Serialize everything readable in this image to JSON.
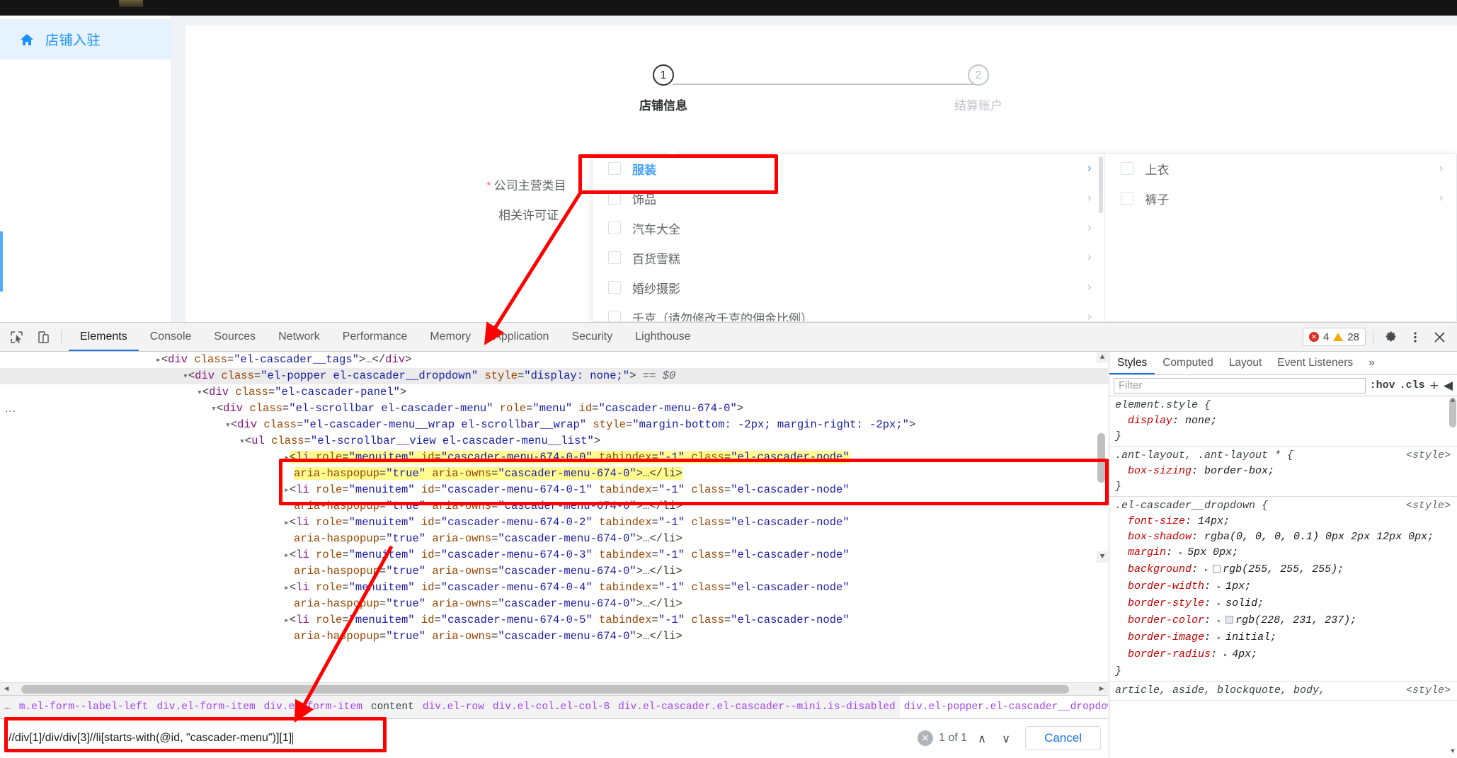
{
  "sidebar": {
    "home_label": "店铺入驻",
    "home_icon": "home-icon"
  },
  "steps": {
    "step1": {
      "number": "1",
      "label": "店铺信息"
    },
    "step2": {
      "number": "2",
      "label": "结算账户"
    }
  },
  "form": {
    "main_category_label": "公司主营类目",
    "required_mark": "*",
    "license_label": "相关许可证"
  },
  "cascader": {
    "column1": [
      {
        "label": "服装",
        "active": true,
        "arrow": "›"
      },
      {
        "label": "饰品",
        "active": false,
        "arrow": "›"
      },
      {
        "label": "汽车大全",
        "active": false,
        "arrow": "›"
      },
      {
        "label": "百货雪糕",
        "active": false,
        "arrow": "›"
      },
      {
        "label": "婚纱摄影",
        "active": false,
        "arrow": "›"
      },
      {
        "label": "千克（请勿修改千克的佣金比例）",
        "active": false,
        "arrow": "›"
      }
    ],
    "column2": [
      {
        "label": "上衣",
        "arrow": "›"
      },
      {
        "label": "裤子",
        "arrow": "›"
      }
    ]
  },
  "devtools": {
    "inspect_icon": "inspect-element-icon",
    "device_icon": "device-toolbar-icon",
    "tabs": [
      {
        "label": "Elements",
        "selected": true
      },
      {
        "label": "Console",
        "selected": false
      },
      {
        "label": "Sources",
        "selected": false
      },
      {
        "label": "Network",
        "selected": false
      },
      {
        "label": "Performance",
        "selected": false
      },
      {
        "label": "Memory",
        "selected": false
      },
      {
        "label": "Application",
        "selected": false
      },
      {
        "label": "Security",
        "selected": false
      },
      {
        "label": "Lighthouse",
        "selected": false
      }
    ],
    "issues": {
      "error_count": "4",
      "warning_count": "28",
      "error_glyph": "×"
    },
    "settings_icon": "gear-icon",
    "more_icon": "kebab-menu-icon",
    "close_icon": "close-icon",
    "dom": {
      "ellipsis_label": "…",
      "rows": [
        {
          "indent": 220,
          "selected": false,
          "parts": [
            {
              "t": "tri",
              "v": "▸"
            },
            {
              "t": "punc",
              "v": "<"
            },
            {
              "t": "tag",
              "v": "div"
            },
            {
              "t": "punc",
              "v": " "
            },
            {
              "t": "attr",
              "v": "class"
            },
            {
              "t": "punc",
              "v": "="
            },
            {
              "t": "val",
              "v": "\"el-cascader__tags\""
            },
            {
              "t": "punc",
              "v": ">"
            },
            {
              "t": "ell",
              "v": "…"
            },
            {
              "t": "punc",
              "v": "</"
            },
            {
              "t": "tag",
              "v": "div"
            },
            {
              "t": "punc",
              "v": ">"
            }
          ]
        },
        {
          "indent": 258,
          "selected": true,
          "parts": [
            {
              "t": "tri",
              "v": "▾"
            },
            {
              "t": "punc",
              "v": "<"
            },
            {
              "t": "tag",
              "v": "div"
            },
            {
              "t": "punc",
              "v": " "
            },
            {
              "t": "attr",
              "v": "class"
            },
            {
              "t": "punc",
              "v": "="
            },
            {
              "t": "val",
              "v": "\"el-popper el-cascader__dropdown\""
            },
            {
              "t": "punc",
              "v": " "
            },
            {
              "t": "attr",
              "v": "style"
            },
            {
              "t": "punc",
              "v": "="
            },
            {
              "t": "val",
              "v": "\"display: none;\""
            },
            {
              "t": "punc",
              "v": ">"
            },
            {
              "t": "dollar",
              "v": " == $0"
            }
          ]
        },
        {
          "indent": 278,
          "selected": false,
          "parts": [
            {
              "t": "tri",
              "v": "▾"
            },
            {
              "t": "punc",
              "v": "<"
            },
            {
              "t": "tag",
              "v": "div"
            },
            {
              "t": "punc",
              "v": " "
            },
            {
              "t": "attr",
              "v": "class"
            },
            {
              "t": "punc",
              "v": "="
            },
            {
              "t": "val",
              "v": "\"el-cascader-panel\""
            },
            {
              "t": "punc",
              "v": ">"
            }
          ]
        },
        {
          "indent": 298,
          "selected": false,
          "parts": [
            {
              "t": "tri",
              "v": "▾"
            },
            {
              "t": "punc",
              "v": "<"
            },
            {
              "t": "tag",
              "v": "div"
            },
            {
              "t": "punc",
              "v": " "
            },
            {
              "t": "attr",
              "v": "class"
            },
            {
              "t": "punc",
              "v": "="
            },
            {
              "t": "val",
              "v": "\"el-scrollbar el-cascader-menu\""
            },
            {
              "t": "punc",
              "v": " "
            },
            {
              "t": "attr",
              "v": "role"
            },
            {
              "t": "punc",
              "v": "="
            },
            {
              "t": "val",
              "v": "\"menu\""
            },
            {
              "t": "punc",
              "v": " "
            },
            {
              "t": "attr",
              "v": "id"
            },
            {
              "t": "punc",
              "v": "="
            },
            {
              "t": "val",
              "v": "\"cascader-menu-674-0\""
            },
            {
              "t": "punc",
              "v": ">"
            }
          ]
        },
        {
          "indent": 318,
          "selected": false,
          "parts": [
            {
              "t": "tri",
              "v": "▾"
            },
            {
              "t": "punc",
              "v": "<"
            },
            {
              "t": "tag",
              "v": "div"
            },
            {
              "t": "punc",
              "v": " "
            },
            {
              "t": "attr",
              "v": "class"
            },
            {
              "t": "punc",
              "v": "="
            },
            {
              "t": "val",
              "v": "\"el-cascader-menu__wrap el-scrollbar__wrap\""
            },
            {
              "t": "punc",
              "v": " "
            },
            {
              "t": "attr",
              "v": "style"
            },
            {
              "t": "punc",
              "v": "="
            },
            {
              "t": "val",
              "v": "\"margin-bottom: -2px; margin-right: -2px;\""
            },
            {
              "t": "punc",
              "v": ">"
            }
          ]
        },
        {
          "indent": 338,
          "selected": false,
          "parts": [
            {
              "t": "tri",
              "v": "▾"
            },
            {
              "t": "punc",
              "v": "<"
            },
            {
              "t": "tag",
              "v": "ul"
            },
            {
              "t": "punc",
              "v": " "
            },
            {
              "t": "attr",
              "v": "class"
            },
            {
              "t": "punc",
              "v": "="
            },
            {
              "t": "val",
              "v": "\"el-scrollbar__view el-cascader-menu__list\""
            },
            {
              "t": "punc",
              "v": ">"
            }
          ]
        }
      ],
      "li_rows": [
        {
          "id": "cascader-menu-674-0-0",
          "highlighted": true
        },
        {
          "id": "cascader-menu-674-0-1",
          "highlighted": false
        },
        {
          "id": "cascader-menu-674-0-2",
          "highlighted": false
        },
        {
          "id": "cascader-menu-674-0-3",
          "highlighted": false
        },
        {
          "id": "cascader-menu-674-0-4",
          "highlighted": false
        },
        {
          "id": "cascader-menu-674-0-5",
          "highlighted": false
        }
      ],
      "li_template": {
        "open": "<",
        "tag": "li",
        "a1": "role",
        "v1": "\"menuitem\"",
        "a2": "id",
        "a3": "tabindex",
        "v3": "\"-1\"",
        "a4": "class",
        "v4": "\"el-cascader-node\"",
        "a5": "aria-haspopup",
        "v5": "\"true\"",
        "a6": "aria-owns",
        "v6": "\"cascader-menu-674-0\"",
        "close": ">…</li>"
      }
    },
    "breadcrumb": [
      {
        "label": "…",
        "kind": "dots"
      },
      {
        "label": "m.el-form--label-left",
        "kind": "css"
      },
      {
        "label": "div.el-form-item",
        "kind": "css"
      },
      {
        "label": "div.el-form-item",
        "kind": "css"
      },
      {
        "label": "content",
        "kind": "plain"
      },
      {
        "label": "div.el-row",
        "kind": "css"
      },
      {
        "label": "div.el-col.el-col-8",
        "kind": "css"
      },
      {
        "label": "div.el-cascader.el-cascader--mini.is-disabled",
        "kind": "css"
      },
      {
        "label": "div.el-popper.el-cascader__dropdown",
        "kind": "css-cur"
      },
      {
        "label": "…",
        "kind": "dots"
      }
    ],
    "search": {
      "query": "//div[1]/div/div[3]//li[starts-with(@id, \"cascader-menu\")][1]",
      "match_count": "1 of 1",
      "prev_icon": "∧",
      "next_icon": "∨",
      "clear_icon": "×",
      "cancel_label": "Cancel"
    },
    "styles": {
      "tabs": [
        {
          "label": "Styles",
          "selected": true
        },
        {
          "label": "Computed",
          "selected": false
        },
        {
          "label": "Layout",
          "selected": false
        },
        {
          "label": "Event Listeners",
          "selected": false
        },
        {
          "label": "»",
          "selected": false
        }
      ],
      "filter_placeholder": "Filter",
      "hov_label": ":hov",
      "cls_label": ".cls",
      "new_rule_icon": "+",
      "sidebar_toggle_icon": "◀",
      "rules": [
        {
          "selector": "element.style",
          "origin": "",
          "decls": [
            {
              "prop": "display",
              "value": "none;",
              "swatch": null,
              "disc": false
            }
          ]
        },
        {
          "selector": ".ant-layout, .ant-layout * ",
          "origin": "<style>",
          "decls": [
            {
              "prop": "box-sizing",
              "value": "border-box;",
              "swatch": null,
              "disc": false
            }
          ]
        },
        {
          "selector": ".el-cascader__dropdown",
          "origin": "<style>",
          "decls": [
            {
              "prop": "font-size",
              "value": "14px;",
              "swatch": null,
              "disc": false
            },
            {
              "prop": "box-shadow",
              "value": "rgba(0, 0, 0, 0.1) 0px 2px 12px 0px;",
              "swatch": null,
              "disc": false
            },
            {
              "prop": "margin",
              "value": "5px 0px;",
              "swatch": null,
              "disc": true
            },
            {
              "prop": "background",
              "value": "rgb(255, 255, 255);",
              "swatch": "#ffffff",
              "disc": true
            },
            {
              "prop": "border-width",
              "value": "1px;",
              "swatch": null,
              "disc": true
            },
            {
              "prop": "border-style",
              "value": "solid;",
              "swatch": null,
              "disc": true
            },
            {
              "prop": "border-color",
              "value": "rgb(228, 231, 237);",
              "swatch": "#e4e7ed",
              "disc": true
            },
            {
              "prop": "border-image",
              "value": "initial;",
              "swatch": null,
              "disc": true
            },
            {
              "prop": "border-radius",
              "value": "4px;",
              "swatch": null,
              "disc": true
            }
          ]
        },
        {
          "selector": "article, aside, blockquote, body,",
          "origin": "<style>",
          "decls": []
        }
      ]
    }
  },
  "colors": {
    "accent_blue": "#1890ff",
    "element_blue": "#409eff",
    "annotation_red": "#ff0000",
    "highlight_yellow": "#fffb8f"
  }
}
